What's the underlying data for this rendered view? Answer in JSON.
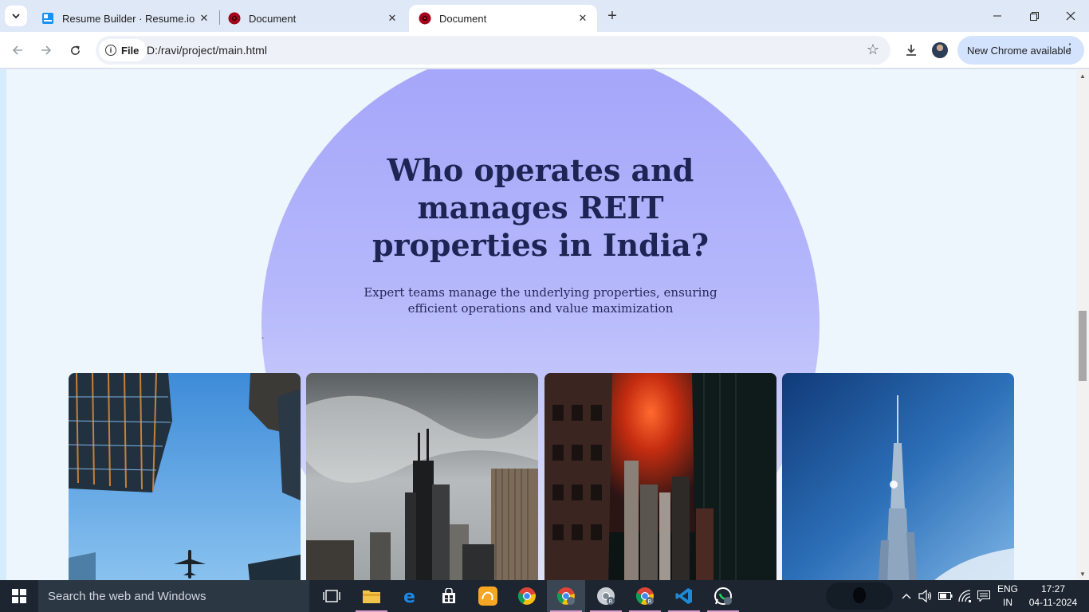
{
  "browser": {
    "tabs": [
      {
        "title": "Resume Builder · Resume.io",
        "favicon": "resumeio-icon",
        "active": false
      },
      {
        "title": "Document",
        "favicon": "red-face-icon",
        "active": false
      },
      {
        "title": "Document",
        "favicon": "red-face-icon",
        "active": true
      }
    ],
    "omnibox": {
      "scheme_label": "File",
      "url": "D:/ravi/project/main.html"
    },
    "update_button_label": "New Chrome available"
  },
  "page": {
    "headline": "Who operates and manages REIT properties in India?",
    "subtext": "Expert teams manage the underlying properties, ensuring efficient operations and value maximization",
    "stray_mark": "`",
    "colors": {
      "circle_top": "#a4a4fa",
      "circle_bottom": "#dde4fa",
      "heading": "#1e2454",
      "background": "#edf5fd"
    },
    "cards": [
      {
        "image": "skyscrapers-airplane-photo"
      },
      {
        "image": "chicago-skyline-bw-photo"
      },
      {
        "image": "city-street-red-sky-photo"
      },
      {
        "image": "burj-khalifa-photo"
      }
    ]
  },
  "taskbar": {
    "search_placeholder": "Search the web and Windows",
    "apps": [
      "task-view-icon",
      "file-explorer-icon",
      "edge-icon",
      "store-icon",
      "uc-browser-icon",
      "chrome-icon",
      "chrome-profile-icon",
      "chrome-profile-r-icon",
      "chrome-r-icon",
      "vscode-icon",
      "whatsapp-icon"
    ],
    "language": {
      "line1": "ENG",
      "line2": "IN"
    },
    "clock": {
      "time": "17:27",
      "date": "04-11-2024"
    }
  }
}
